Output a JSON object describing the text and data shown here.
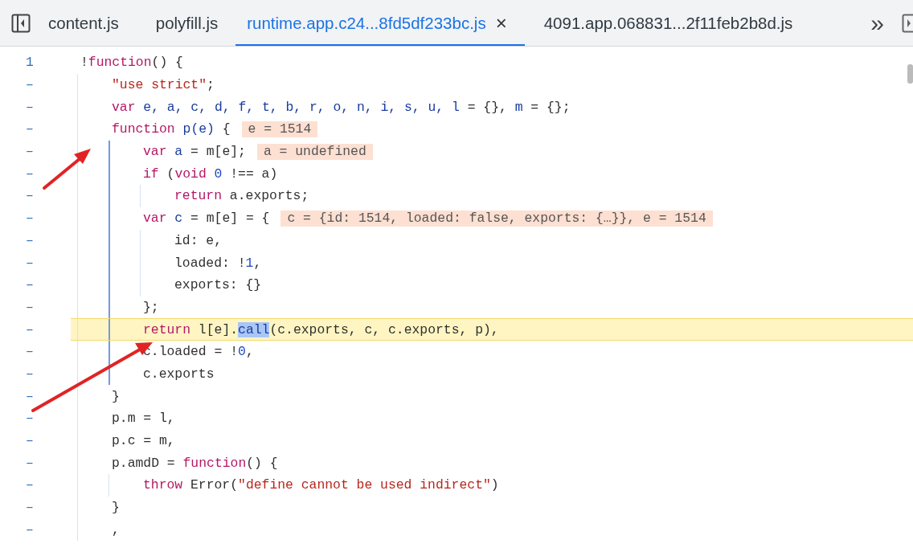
{
  "tabs": [
    {
      "label": "content.js",
      "selected": false
    },
    {
      "label": "polyfill.js",
      "selected": false
    },
    {
      "label": "runtime.app.c24...8fd5df233bc.js",
      "selected": true,
      "close_icon": "×"
    },
    {
      "label": "4091.app.068831...2f11feb2b8d.js",
      "selected": false
    }
  ],
  "overflow_button": "»",
  "editor": {
    "lines": [
      {
        "number": "1",
        "paused": false,
        "active_scope": false,
        "tokens": [
          {
            "text": "!",
            "kind": "plain"
          },
          {
            "text": "function",
            "kind": "kw"
          },
          {
            "text": "() {",
            "kind": "plain"
          }
        ],
        "children": [
          {
            "number": "–",
            "paused": false,
            "tokens": [
              {
                "text": "\"use strict\"",
                "kind": "str"
              },
              {
                "text": ";",
                "kind": "plain"
              }
            ]
          },
          {
            "number": "–",
            "paused": false,
            "tokens": [
              {
                "text": "var",
                "kind": "kw"
              },
              {
                "text": " e, a, c, d, f, t, b, r, o, n, i, s, u, l",
                "kind": "def"
              },
              {
                "text": " = {}, ",
                "kind": "plain"
              },
              {
                "text": "m",
                "kind": "def"
              },
              {
                "text": " = {};",
                "kind": "plain"
              }
            ]
          },
          {
            "number": "–",
            "paused": false,
            "active_scope": true,
            "tokens": [
              {
                "text": "function",
                "kind": "kw"
              },
              {
                "text": " p(e)",
                "kind": "def"
              },
              {
                "text": " {",
                "kind": "plain"
              }
            ],
            "inline_value": "e = 1514",
            "children": [
              {
                "number": "–",
                "paused": false,
                "tokens": [
                  {
                    "text": "var",
                    "kind": "kw"
                  },
                  {
                    "text": " a",
                    "kind": "def"
                  },
                  {
                    "text": " = m[e];",
                    "kind": "plain"
                  }
                ],
                "inline_value": "a = undefined"
              },
              {
                "number": "–",
                "paused": false,
                "active_scope": false,
                "tokens": [
                  {
                    "text": "if",
                    "kind": "kw"
                  },
                  {
                    "text": " (",
                    "kind": "plain"
                  },
                  {
                    "text": "void",
                    "kind": "kw"
                  },
                  {
                    "text": " 0",
                    "kind": "num"
                  },
                  {
                    "text": " !== a)",
                    "kind": "plain"
                  }
                ],
                "children": [
                  {
                    "number": "–",
                    "paused": false,
                    "tokens": [
                      {
                        "text": "return",
                        "kind": "kw"
                      },
                      {
                        "text": " a.exports;",
                        "kind": "plain"
                      }
                    ]
                  }
                ]
              },
              {
                "number": "–",
                "paused": false,
                "active_scope": false,
                "tokens": [
                  {
                    "text": "var",
                    "kind": "kw"
                  },
                  {
                    "text": " c",
                    "kind": "def"
                  },
                  {
                    "text": " = m[e] = {",
                    "kind": "plain"
                  }
                ],
                "inline_value": "c = {id: 1514, loaded: false, exports: {…}}, e = 1514",
                "children": [
                  {
                    "number": "–",
                    "paused": false,
                    "tokens": [
                      {
                        "text": "id: e,",
                        "kind": "plain"
                      }
                    ]
                  },
                  {
                    "number": "–",
                    "paused": false,
                    "tokens": [
                      {
                        "text": "loaded: !",
                        "kind": "plain"
                      },
                      {
                        "text": "1",
                        "kind": "num"
                      },
                      {
                        "text": ",",
                        "kind": "plain"
                      }
                    ]
                  },
                  {
                    "number": "–",
                    "paused": false,
                    "tokens": [
                      {
                        "text": "exports: {}",
                        "kind": "plain"
                      }
                    ]
                  }
                ]
              },
              {
                "number": "–",
                "paused": false,
                "tokens": [
                  {
                    "text": "};",
                    "kind": "plain"
                  }
                ]
              },
              {
                "number": "–",
                "paused": true,
                "tokens": [
                  {
                    "text": "return",
                    "kind": "kw"
                  },
                  {
                    "text": " l[e].",
                    "kind": "plain"
                  },
                  {
                    "text": "call",
                    "kind": "sel"
                  },
                  {
                    "text": "(c.exports, c, c.exports, p),",
                    "kind": "plain"
                  }
                ]
              },
              {
                "number": "–",
                "paused": false,
                "tokens": [
                  {
                    "text": "c.loaded = !",
                    "kind": "plain"
                  },
                  {
                    "text": "0",
                    "kind": "num"
                  },
                  {
                    "text": ",",
                    "kind": "plain"
                  }
                ]
              },
              {
                "number": "–",
                "paused": false,
                "tokens": [
                  {
                    "text": "c.exports",
                    "kind": "plain"
                  }
                ]
              }
            ]
          },
          {
            "number": "–",
            "paused": false,
            "tokens": [
              {
                "text": "}",
                "kind": "plain"
              }
            ]
          },
          {
            "number": "–",
            "paused": false,
            "tokens": [
              {
                "text": "p.m = l,",
                "kind": "plain"
              }
            ]
          },
          {
            "number": "–",
            "paused": false,
            "tokens": [
              {
                "text": "p.c = m,",
                "kind": "plain"
              }
            ]
          },
          {
            "number": "–",
            "paused": false,
            "active_scope": false,
            "tokens": [
              {
                "text": "p.amdD = ",
                "kind": "plain"
              },
              {
                "text": "function",
                "kind": "kw"
              },
              {
                "text": "() {",
                "kind": "plain"
              }
            ],
            "children": [
              {
                "number": "–",
                "paused": false,
                "tokens": [
                  {
                    "text": "throw",
                    "kind": "kw"
                  },
                  {
                    "text": " Error(",
                    "kind": "plain"
                  },
                  {
                    "text": "\"define cannot be used indirect\"",
                    "kind": "str"
                  },
                  {
                    "text": ")",
                    "kind": "plain"
                  }
                ]
              }
            ]
          },
          {
            "number": "–",
            "paused": false,
            "tokens": [
              {
                "text": "}",
                "kind": "plain"
              }
            ]
          },
          {
            "number": "–",
            "paused": false,
            "tokens": [
              {
                "text": ",",
                "kind": "plain"
              }
            ]
          }
        ]
      }
    ]
  }
}
